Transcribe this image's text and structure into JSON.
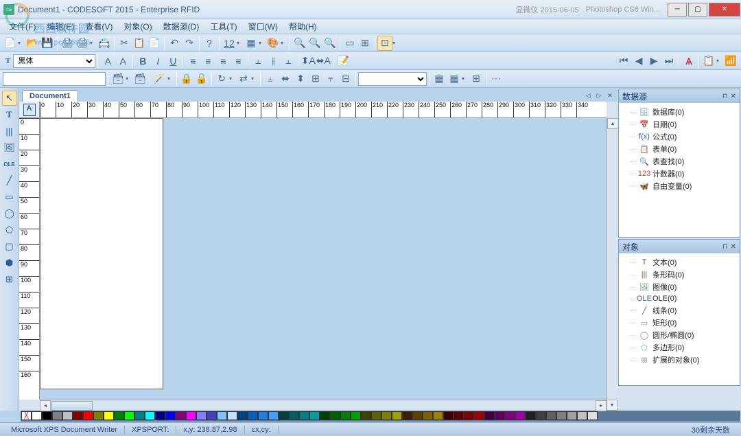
{
  "title": "Document1 - CODESOFT 2015 - Enterprise RFID",
  "watermark_text": "西西软件园",
  "watermark_url": "www.pc0359.cn",
  "faded_title_1": "显微仪 2015-06-05",
  "faded_title_2": "Photoshop CS6 Win...",
  "menu": {
    "file": "文件(F)",
    "edit": "编辑(E)",
    "view": "查看(V)",
    "object": "对象(O)",
    "datasource": "数据源(D)",
    "tool": "工具(T)",
    "window": "窗口(W)",
    "help": "帮助(H)"
  },
  "font_name": "黑体",
  "font_size": "12",
  "doc_tab": "Document1",
  "ruler_corner": "A",
  "h_ticks": [
    "0",
    "10",
    "20",
    "30",
    "40",
    "50",
    "60",
    "70",
    "80",
    "90",
    "100",
    "110",
    "120",
    "130",
    "140",
    "150",
    "160",
    "170",
    "180",
    "190",
    "200",
    "210",
    "220",
    "230",
    "240",
    "250",
    "260",
    "270",
    "280",
    "290",
    "300",
    "310",
    "320",
    "330",
    "340"
  ],
  "v_ticks": [
    "0",
    "10",
    "20",
    "30",
    "40",
    "50",
    "60",
    "70",
    "80",
    "90",
    "100",
    "110",
    "120",
    "130",
    "140",
    "150",
    "160"
  ],
  "panels": {
    "datasource": {
      "title": "数据源",
      "items": [
        {
          "icon": "🗄",
          "label": "数据库(0)",
          "color": "#4a8ac8"
        },
        {
          "icon": "📅",
          "label": "日期(0)",
          "color": "#d08040"
        },
        {
          "icon": "f(x)",
          "label": "公式(0)",
          "color": "#3060c0"
        },
        {
          "icon": "📋",
          "label": "表单(0)",
          "color": "#8a6a3a"
        },
        {
          "icon": "🔍",
          "label": "表查找(0)",
          "color": "#7a5a3a"
        },
        {
          "icon": "123",
          "label": "计数器(0)",
          "color": "#c04040"
        },
        {
          "icon": "🦋",
          "label": "自由变量(0)",
          "color": "#4080c8"
        }
      ]
    },
    "objects": {
      "title": "对象",
      "items": [
        {
          "icon": "T",
          "label": "文本(0)",
          "color": "#2a5aaa"
        },
        {
          "icon": "|||",
          "label": "条形码(0)",
          "color": "#7a5a3a"
        },
        {
          "icon": "🖼",
          "label": "图像(0)",
          "color": "#5a8a5a"
        },
        {
          "icon": "OLE",
          "label": "OLE(0)",
          "color": "#3060a0"
        },
        {
          "icon": "╱",
          "label": "线条(0)",
          "color": "#666"
        },
        {
          "icon": "▭",
          "label": "矩形(0)",
          "color": "#888"
        },
        {
          "icon": "◯",
          "label": "圆形/椭圆(0)",
          "color": "#888"
        },
        {
          "icon": "⬠",
          "label": "多边形(0)",
          "color": "#6aa"
        },
        {
          "icon": "⊞",
          "label": "扩展的对象(0)",
          "color": "#888"
        }
      ]
    }
  },
  "colors": [
    "#ffffff",
    "#000000",
    "#808080",
    "#c0c0c0",
    "#800000",
    "#ff0000",
    "#808000",
    "#ffff00",
    "#008000",
    "#00ff00",
    "#008080",
    "#00ffff",
    "#000080",
    "#0000ff",
    "#800080",
    "#ff00ff",
    "#8080ff",
    "#4040c0",
    "#80c0ff",
    "#c0e0ff",
    "#004080",
    "#0060c0",
    "#2080e0",
    "#40a0ff",
    "#004040",
    "#006060",
    "#008080",
    "#00a0a0",
    "#004000",
    "#006000",
    "#008000",
    "#00a000",
    "#404000",
    "#606000",
    "#808000",
    "#a0a000",
    "#402000",
    "#604000",
    "#806000",
    "#a08000",
    "#400000",
    "#600000",
    "#800000",
    "#a00000",
    "#400040",
    "#600060",
    "#800080",
    "#a000a0",
    "#202020",
    "#404040",
    "#606060",
    "#808080",
    "#a0a0a0",
    "#c0c0c0",
    "#e0e0e0"
  ],
  "status": {
    "printer": "Microsoft XPS Document Writer",
    "port": "XPSPORT:",
    "xy_label": "x,y: 238.87,2.98",
    "cxcy": "cx,cy:",
    "trial": "30剩余天数"
  }
}
